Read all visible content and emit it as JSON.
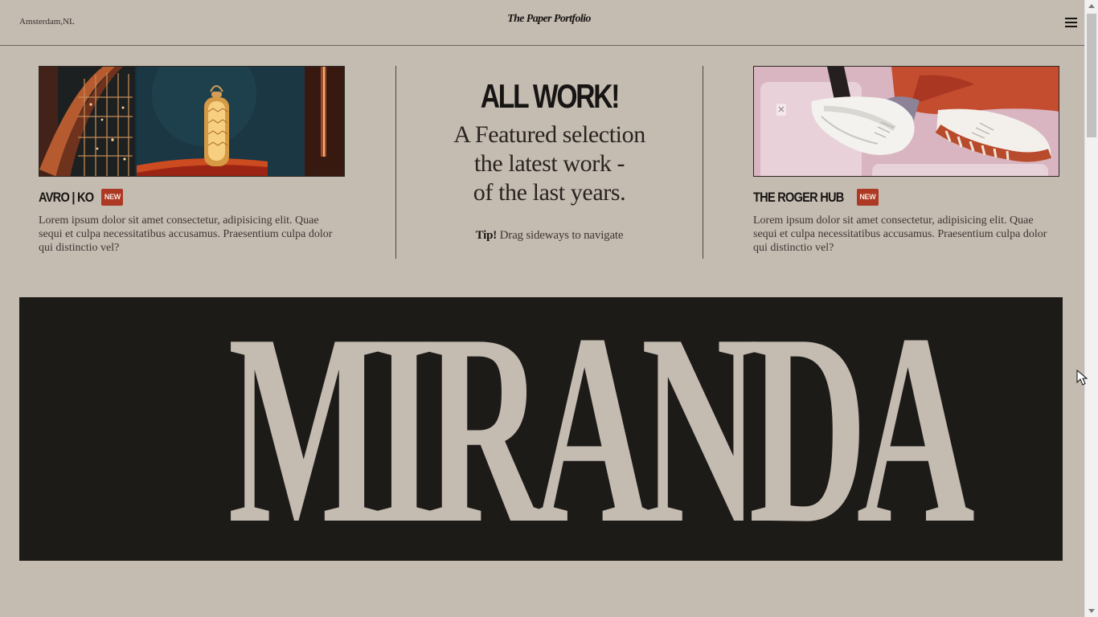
{
  "header": {
    "location": "Amsterdam,NL",
    "brand": "The Paper Portfolio",
    "menu_icon": "hamburger-menu-icon"
  },
  "featured": {
    "heading": "ALL WORK!",
    "line_1": "A Featured selection",
    "line_2": "the latest work -",
    "line_3": "of the last years.",
    "tip_label": "Tip!",
    "tip_text": " Drag sideways to navigate"
  },
  "projects": [
    {
      "title": "AVRO | KO",
      "badge": "NEW",
      "description": "Lorem ipsum dolor sit amet consectetur, adipisicing elit. Quae sequi et culpa necessitatibus accusamus. Praesentium culpa dolor qui distinctio vel?",
      "image": "lantern-interior-thumbnail"
    },
    {
      "title": "THE ROGER HUB",
      "badge": "NEW",
      "description": "Lorem ipsum dolor sit amet consectetur, adipisicing elit. Quae sequi et culpa necessitatibus accusamus. Praesentium culpa dolor qui distinctio vel?",
      "image": "white-sneakers-thumbnail"
    }
  ],
  "hero": {
    "title": "MIRANDA"
  },
  "colors": {
    "page_background": "#c4bbb1",
    "ink": "#171513",
    "badge": "#ad3823",
    "hero_background": "#1d1b18"
  }
}
